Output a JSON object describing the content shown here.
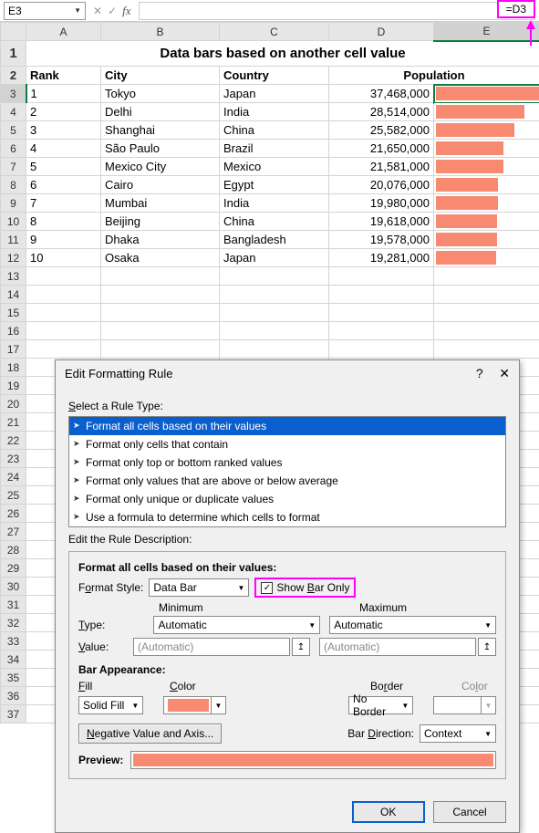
{
  "fxbar": {
    "cell_ref": "E3",
    "fx": "fx",
    "formula": "=D3"
  },
  "cols": [
    "",
    "A",
    "B",
    "C",
    "D",
    "E"
  ],
  "title": "Data bars based on another cell value",
  "headers": {
    "a": "Rank",
    "b": "City",
    "c": "Country",
    "pop": "Population"
  },
  "rows": [
    {
      "r": "1",
      "city": "Tokyo",
      "country": "Japan",
      "pop": "37,468,000",
      "bar": 100
    },
    {
      "r": "2",
      "city": "Delhi",
      "country": "India",
      "pop": "28,514,000",
      "bar": 84
    },
    {
      "r": "3",
      "city": "Shanghai",
      "country": "China",
      "pop": "25,582,000",
      "bar": 75
    },
    {
      "r": "4",
      "city": "São Paulo",
      "country": "Brazil",
      "pop": "21,650,000",
      "bar": 64
    },
    {
      "r": "5",
      "city": "Mexico City",
      "country": "Mexico",
      "pop": "21,581,000",
      "bar": 64
    },
    {
      "r": "6",
      "city": "Cairo",
      "country": "Egypt",
      "pop": "20,076,000",
      "bar": 59
    },
    {
      "r": "7",
      "city": "Mumbai",
      "country": "India",
      "pop": "19,980,000",
      "bar": 59
    },
    {
      "r": "8",
      "city": "Beijing",
      "country": "China",
      "pop": "19,618,000",
      "bar": 58
    },
    {
      "r": "9",
      "city": "Dhaka",
      "country": "Bangladesh",
      "pop": "19,578,000",
      "bar": 58
    },
    {
      "r": "10",
      "city": "Osaka",
      "country": "Japan",
      "pop": "19,281,000",
      "bar": 57
    }
  ],
  "dialog": {
    "title": "Edit Formatting Rule",
    "select_rule": "Select a Rule Type:",
    "rules": [
      "Format all cells based on their values",
      "Format only cells that contain",
      "Format only top or bottom ranked values",
      "Format only values that are above or below average",
      "Format only unique or duplicate values",
      "Use a formula to determine which cells to format"
    ],
    "edit_desc": "Edit the Rule Description:",
    "fmt_all": "Format all cells based on their values:",
    "format_style": "Format Style:",
    "style_value": "Data Bar",
    "show_bar_only": "Show Bar Only",
    "minimum": "Minimum",
    "maximum": "Maximum",
    "type": "Type:",
    "value": "Value:",
    "automatic": "Automatic",
    "auto_paren": "(Automatic)",
    "bar_appearance": "Bar Appearance:",
    "fill": "Fill",
    "color": "Color",
    "border": "Border",
    "solid_fill": "Solid Fill",
    "no_border": "No Border",
    "neg_axis": "Negative Value and Axis...",
    "bar_direction": "Bar Direction:",
    "context": "Context",
    "preview": "Preview:",
    "ok": "OK",
    "cancel": "Cancel"
  }
}
